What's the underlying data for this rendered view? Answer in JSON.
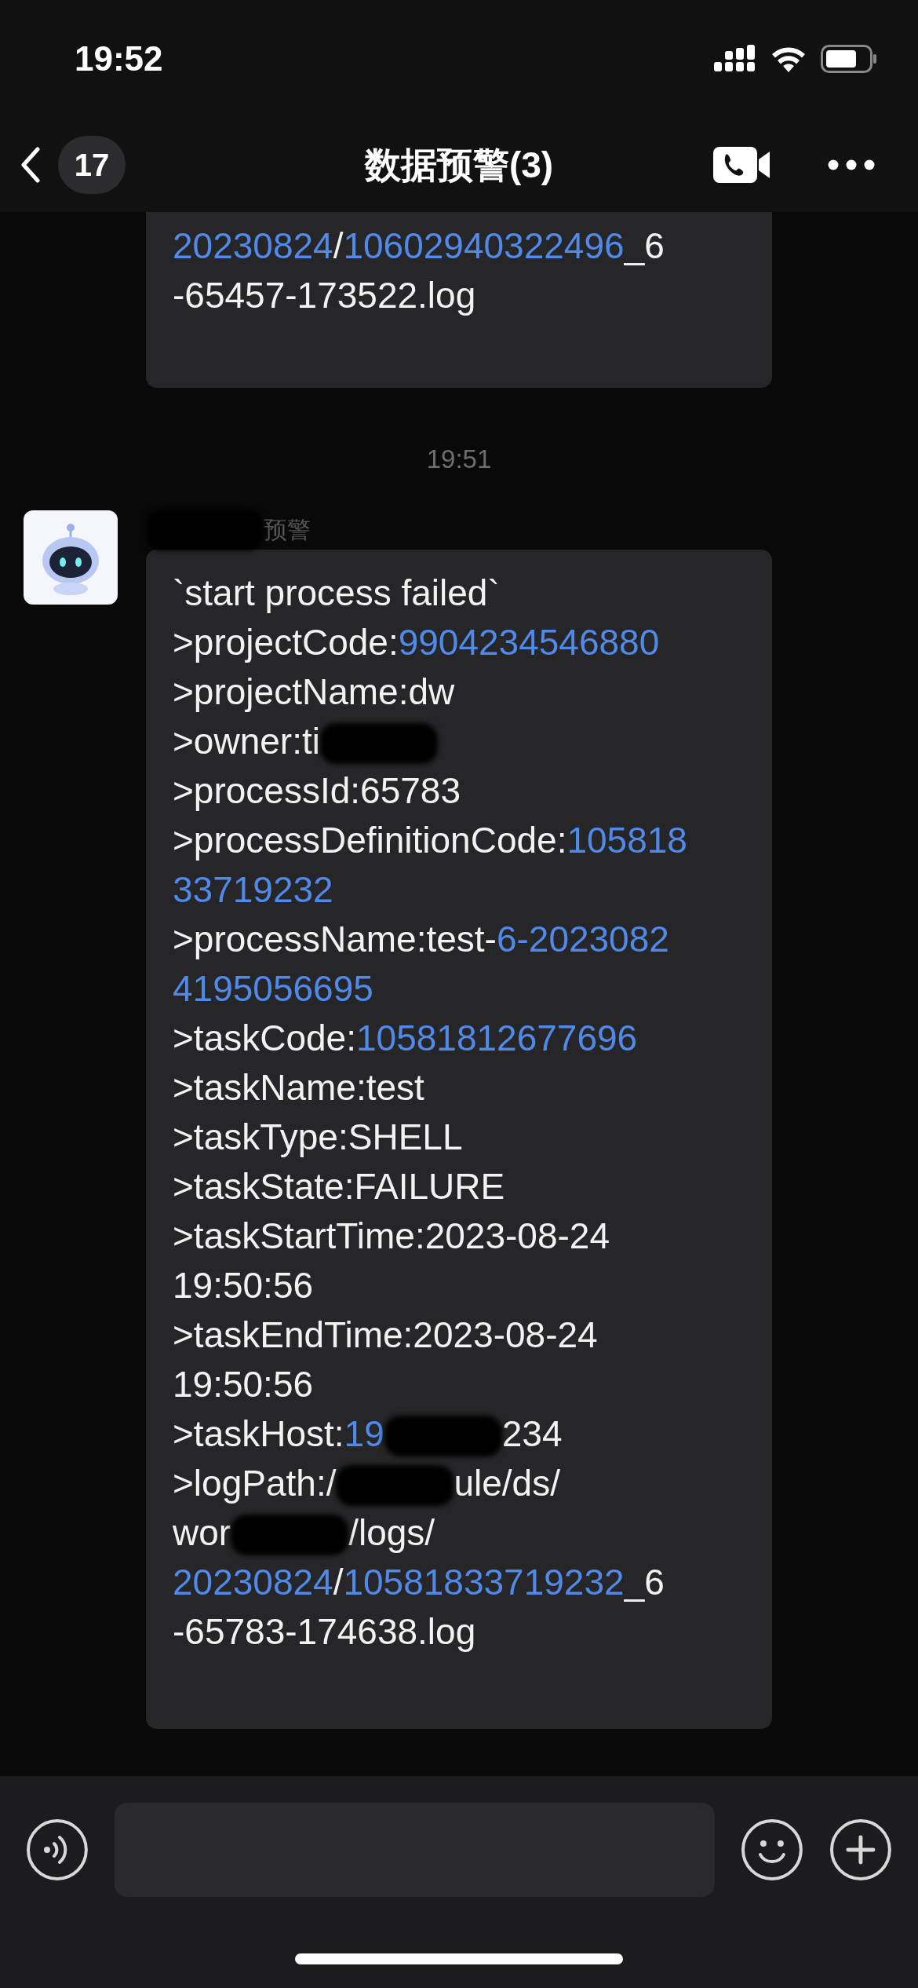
{
  "status_bar": {
    "time": "19:52"
  },
  "nav": {
    "back_count": "17",
    "title": "数据预警(3)"
  },
  "messages": [
    {
      "kind": "continued",
      "lines": [
        [
          {
            "kind": "text",
            "text": "20230824",
            "link": true
          },
          {
            "kind": "text",
            "text": "/",
            "link": false
          },
          {
            "kind": "text",
            "text": "10602940322496",
            "link": true
          },
          {
            "kind": "text",
            "text": "_6",
            "link": false
          }
        ],
        [
          {
            "kind": "text",
            "text": "-65457-173522.log",
            "link": false
          }
        ]
      ]
    },
    {
      "kind": "timestamp",
      "text": "19:51"
    },
    {
      "kind": "incoming",
      "sender": [
        {
          "kind": "redaction"
        },
        {
          "kind": "text",
          "text": "预警",
          "link": false
        }
      ],
      "lines": [
        [
          {
            "kind": "text",
            "text": "`start process failed`",
            "link": false
          }
        ],
        [
          {
            "kind": "text",
            "text": ">projectCode:",
            "link": false
          },
          {
            "kind": "text",
            "text": "9904234546880",
            "link": true
          }
        ],
        [
          {
            "kind": "text",
            "text": ">projectName:dw",
            "link": false
          }
        ],
        [
          {
            "kind": "text",
            "text": ">owner:ti",
            "link": false
          },
          {
            "kind": "redaction"
          }
        ],
        [
          {
            "kind": "text",
            "text": ">processId:65783",
            "link": false
          }
        ],
        [
          {
            "kind": "text",
            "text": ">processDefinitionCode:",
            "link": false
          },
          {
            "kind": "text",
            "text": "105818",
            "link": true
          }
        ],
        [
          {
            "kind": "text",
            "text": "33719232",
            "link": true
          }
        ],
        [
          {
            "kind": "text",
            "text": ">processName:test-",
            "link": false
          },
          {
            "kind": "text",
            "text": "6-2023082",
            "link": true
          }
        ],
        [
          {
            "kind": "text",
            "text": "4195056695",
            "link": true
          }
        ],
        [
          {
            "kind": "text",
            "text": ">taskCode:",
            "link": false
          },
          {
            "kind": "text",
            "text": "10581812677696",
            "link": true
          }
        ],
        [
          {
            "kind": "text",
            "text": ">taskName:test",
            "link": false
          }
        ],
        [
          {
            "kind": "text",
            "text": ">taskType:SHELL",
            "link": false
          }
        ],
        [
          {
            "kind": "text",
            "text": ">taskState:FAILURE",
            "link": false
          }
        ],
        [
          {
            "kind": "text",
            "text": ">taskStartTime:2023-08-24",
            "link": false
          }
        ],
        [
          {
            "kind": "text",
            "text": "19:50:56",
            "link": false
          }
        ],
        [
          {
            "kind": "text",
            "text": ">taskEndTime:2023-08-24",
            "link": false
          }
        ],
        [
          {
            "kind": "text",
            "text": "19:50:56",
            "link": false
          }
        ],
        [
          {
            "kind": "text",
            "text": ">taskHost:",
            "link": false
          },
          {
            "kind": "text",
            "text": "19",
            "link": true
          },
          {
            "kind": "redaction"
          },
          {
            "kind": "text",
            "text": "234",
            "link": false
          }
        ],
        [
          {
            "kind": "text",
            "text": ">logPath:/",
            "link": false
          },
          {
            "kind": "redaction"
          },
          {
            "kind": "text",
            "text": "ule/ds/",
            "link": false
          }
        ],
        [
          {
            "kind": "text",
            "text": "wor",
            "link": false
          },
          {
            "kind": "redaction"
          },
          {
            "kind": "text",
            "text": "/logs/",
            "link": false
          }
        ],
        [
          {
            "kind": "text",
            "text": "20230824",
            "link": true
          },
          {
            "kind": "text",
            "text": "/",
            "link": false
          },
          {
            "kind": "text",
            "text": "10581833719232",
            "link": true
          },
          {
            "kind": "text",
            "text": "_6",
            "link": false
          }
        ],
        [
          {
            "kind": "text",
            "text": "-65783-174638.log",
            "link": false
          }
        ]
      ]
    }
  ]
}
